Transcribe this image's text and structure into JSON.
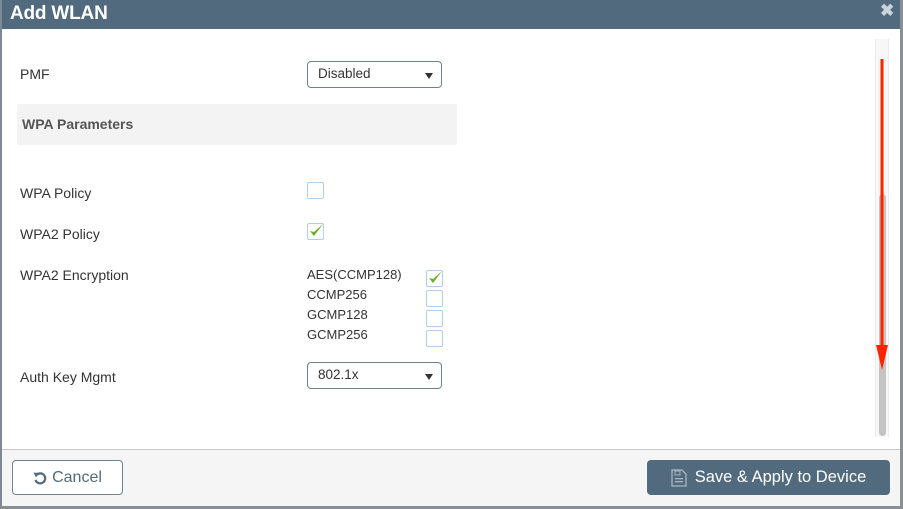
{
  "dialog": {
    "title": "Add WLAN",
    "close_icon": "close-icon"
  },
  "form": {
    "pmf": {
      "label": "PMF",
      "value": "Disabled"
    },
    "section_title": "WPA Parameters",
    "wpa_policy": {
      "label": "WPA Policy",
      "checked": false
    },
    "wpa2_policy": {
      "label": "WPA2 Policy",
      "checked": true
    },
    "wpa2_encryption": {
      "label": "WPA2 Encryption",
      "options": [
        {
          "label": "AES(CCMP128)",
          "checked": true
        },
        {
          "label": "CCMP256",
          "checked": false
        },
        {
          "label": "GCMP128",
          "checked": false
        },
        {
          "label": "GCMP256",
          "checked": false
        }
      ]
    },
    "auth_key_mgmt": {
      "label": "Auth Key Mgmt",
      "value": "802.1x"
    }
  },
  "annotation": {
    "arrow_color": "#ff2200",
    "direction": "down"
  },
  "footer": {
    "cancel_label": "Cancel",
    "save_label": "Save & Apply to Device"
  },
  "colors": {
    "header_bg": "#516a7e",
    "check_green": "#6aac2e",
    "checkbox_border": "#aecff5"
  }
}
